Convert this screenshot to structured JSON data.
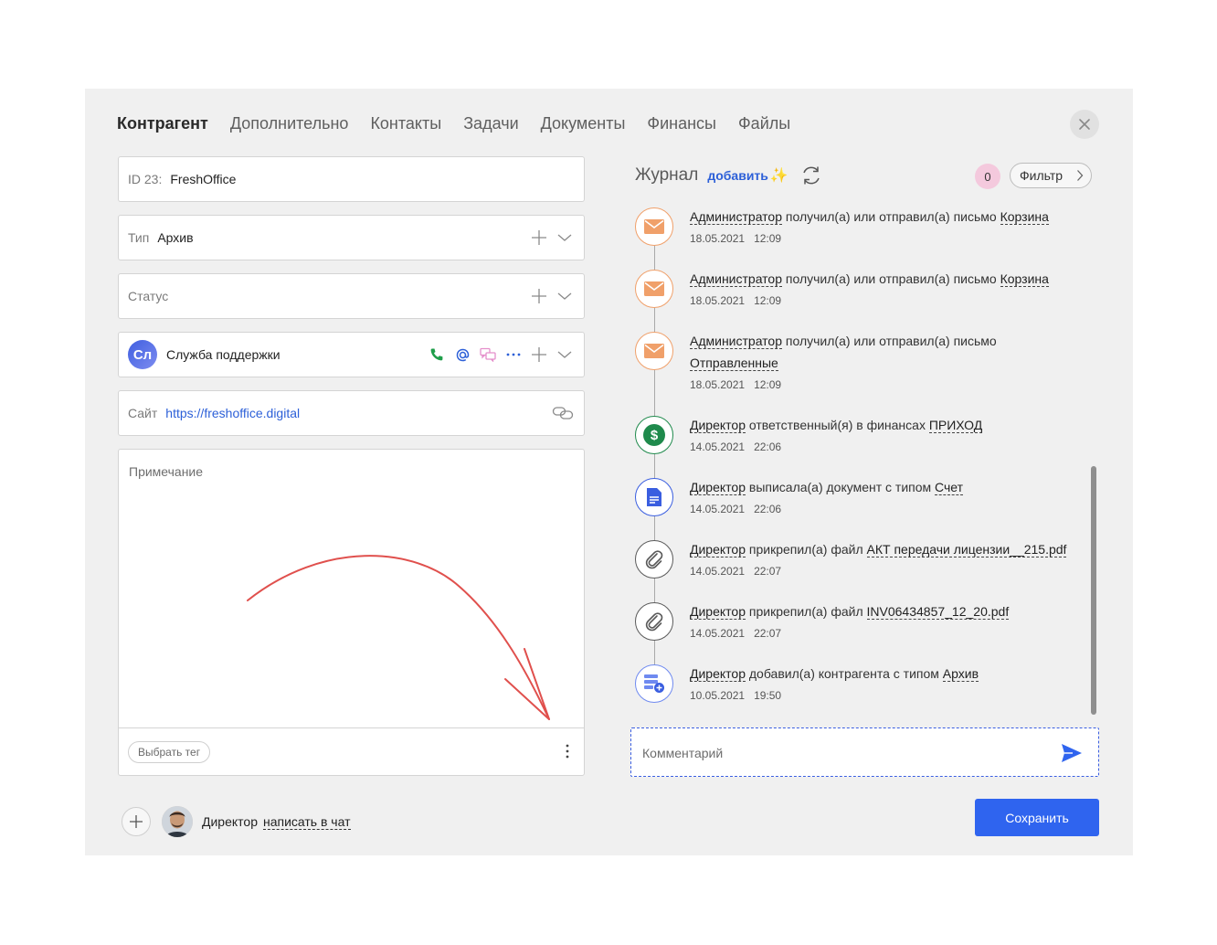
{
  "tabs": [
    {
      "label": "Контрагент"
    },
    {
      "label": "Дополнительно"
    },
    {
      "label": "Контакты"
    },
    {
      "label": "Задачи"
    },
    {
      "label": "Документы"
    },
    {
      "label": "Финансы"
    },
    {
      "label": "Файлы"
    }
  ],
  "form": {
    "id_label": "ID 23:",
    "id_value": "FreshOffice",
    "type_label": "Тип",
    "type_value": "Архив",
    "status_placeholder": "Статус",
    "responsible_initials": "Сл",
    "responsible_name": "Служба поддержки",
    "site_label": "Сайт",
    "site_value": "https://freshoffice.digital",
    "note_placeholder": "Примечание",
    "tag_button": "Выбрать тег"
  },
  "footer": {
    "user_name": "Директор",
    "chat_link": "написать в чат",
    "save_button": "Сохранить"
  },
  "journal": {
    "title": "Журнал",
    "add_label": "добавить",
    "counter": "0",
    "filter_label": "Фильтр",
    "comment_placeholder": "Комментарий",
    "events": [
      {
        "actor": "Администратор",
        "text": "получил(а) или отправил(а) письмо",
        "object": "Корзина",
        "date": "18.05.2021",
        "time": "12:09",
        "icon": "mail-icon"
      },
      {
        "actor": "Администратор",
        "text": "получил(а) или отправил(а) письмо",
        "object": "Корзина",
        "date": "18.05.2021",
        "time": "12:09",
        "icon": "mail-icon"
      },
      {
        "actor": "Администратор",
        "text": "получил(а) или отправил(а) письмо",
        "object": "Отправленные",
        "date": "18.05.2021",
        "time": "12:09",
        "icon": "mail-icon"
      },
      {
        "actor": "Директор",
        "text": "ответственный(я) в финансах",
        "object": "ПРИХОД",
        "date": "14.05.2021",
        "time": "22:06",
        "icon": "finance-icon"
      },
      {
        "actor": "Директор",
        "text": "выписала(а) документ с типом",
        "object": "Счет",
        "date": "14.05.2021",
        "time": "22:06",
        "icon": "document-icon"
      },
      {
        "actor": "Директор",
        "text": "прикрепил(а) файл",
        "object": "АКТ передачи лицензии__215.pdf",
        "date": "14.05.2021",
        "time": "22:07",
        "icon": "paperclip-icon"
      },
      {
        "actor": "Директор",
        "text": "прикрепил(а) файл",
        "object": "INV06434857_12_20.pdf",
        "date": "14.05.2021",
        "time": "22:07",
        "icon": "paperclip-icon"
      },
      {
        "actor": "Директор",
        "text": "добавил(а) контрагента с типом",
        "object": "Архив",
        "date": "10.05.2021",
        "time": "19:50",
        "icon": "add-contractor-icon"
      }
    ]
  },
  "colors": {
    "accent": "#2f64ef",
    "mail": "#f0a06a",
    "finance": "#1f8a4c",
    "document": "#3a5ee0",
    "attachment": "#5a5a5a",
    "annotation_arrow": "#e0504d"
  }
}
